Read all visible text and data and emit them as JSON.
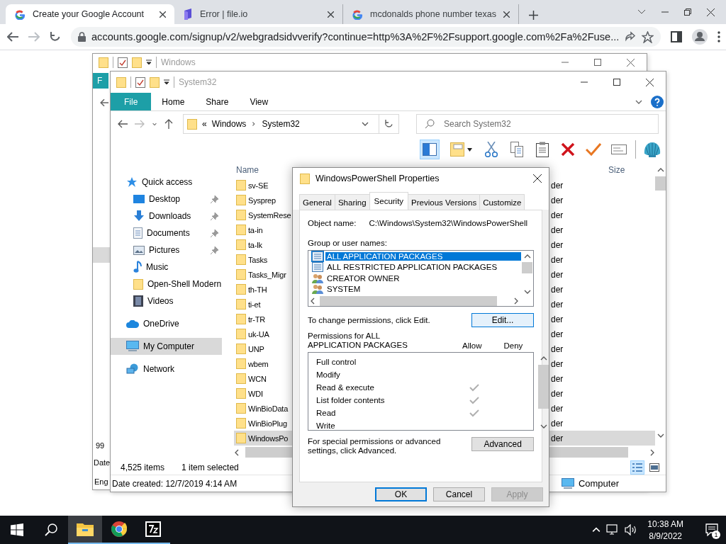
{
  "browser": {
    "tabs": [
      {
        "title": "Create your Google Account",
        "kind": "google",
        "selected": true
      },
      {
        "title": "Error | file.io",
        "kind": "fileio",
        "selected": false
      },
      {
        "title": "mcdonalds phone number texas",
        "kind": "google",
        "selected": false
      }
    ],
    "url": "accounts.google.com/signup/v2/webgradsidvverify?continue=http%3A%2F%2Fsupport.google.com%2Fa%2Fuse..."
  },
  "back_window": {
    "title": "Windows",
    "ribbon_tab": "F",
    "item_count": "99",
    "status_text": "Date",
    "details_text": "Eng"
  },
  "explorer": {
    "title": "System32",
    "ribbon_tabs": [
      {
        "label": "File",
        "selected": true
      },
      {
        "label": "Home",
        "selected": false
      },
      {
        "label": "Share",
        "selected": false
      },
      {
        "label": "View",
        "selected": false
      }
    ],
    "address": {
      "overflow": "«",
      "crumbs": [
        "Windows",
        "System32"
      ]
    },
    "search": {
      "placeholder": "Search System32"
    },
    "nav": [
      {
        "label": "Quick access",
        "kind": "star",
        "selected": false,
        "children": [
          {
            "label": "Desktop",
            "kind": "desktop",
            "pinned": true
          },
          {
            "label": "Downloads",
            "kind": "downloads",
            "pinned": true
          },
          {
            "label": "Documents",
            "kind": "documents",
            "pinned": true
          },
          {
            "label": "Pictures",
            "kind": "pictures",
            "pinned": true
          },
          {
            "label": "Music",
            "kind": "music",
            "pinned": false
          },
          {
            "label": "Open-Shell Modern",
            "kind": "folder",
            "pinned": false
          },
          {
            "label": "Videos",
            "kind": "videos",
            "pinned": false
          }
        ]
      },
      {
        "label": "OneDrive",
        "kind": "cloud",
        "selected": false
      },
      {
        "label": "My Computer",
        "kind": "computer",
        "selected": true
      },
      {
        "label": "Network",
        "kind": "network",
        "selected": false
      }
    ],
    "columns": [
      "Name",
      "Size"
    ],
    "rows": [
      {
        "name": "sv-SE",
        "type": "der",
        "selected": false
      },
      {
        "name": "Sysprep",
        "type": "der",
        "selected": false
      },
      {
        "name": "SystemRese",
        "type": "der",
        "selected": false
      },
      {
        "name": "ta-in",
        "type": "der",
        "selected": false
      },
      {
        "name": "ta-lk",
        "type": "der",
        "selected": false
      },
      {
        "name": "Tasks",
        "type": "der",
        "selected": false
      },
      {
        "name": "Tasks_Migr",
        "type": "der",
        "selected": false
      },
      {
        "name": "th-TH",
        "type": "der",
        "selected": false
      },
      {
        "name": "ti-et",
        "type": "der",
        "selected": false
      },
      {
        "name": "tr-TR",
        "type": "der",
        "selected": false
      },
      {
        "name": "uk-UA",
        "type": "der",
        "selected": false
      },
      {
        "name": "UNP",
        "type": "der",
        "selected": false
      },
      {
        "name": "wbem",
        "type": "der",
        "selected": false
      },
      {
        "name": "WCN",
        "type": "der",
        "selected": false
      },
      {
        "name": "WDI",
        "type": "der",
        "selected": false
      },
      {
        "name": "WinBioData",
        "type": "der",
        "selected": false
      },
      {
        "name": "WinBioPlug",
        "type": "der",
        "selected": false
      },
      {
        "name": "WindowsPo",
        "type": "der",
        "selected": true
      }
    ],
    "status": {
      "items": "4,525 items",
      "selection": "1 item selected"
    },
    "details": {
      "date": "Date created: 12/7/2019 4:14 AM",
      "location": "Computer"
    }
  },
  "dialog": {
    "title": "WindowsPowerShell Properties",
    "tabs": [
      {
        "label": "General",
        "selected": false
      },
      {
        "label": "Sharing",
        "selected": false
      },
      {
        "label": "Security",
        "selected": true
      },
      {
        "label": "Previous Versions",
        "selected": false
      },
      {
        "label": "Customize",
        "selected": false
      }
    ],
    "object_label": "Object name:",
    "object_value": "C:\\Windows\\System32\\WindowsPowerShell",
    "groups_label": "Group or user names:",
    "groups": [
      {
        "name": "ALL APPLICATION PACKAGES",
        "kind": "package",
        "selected": true
      },
      {
        "name": "ALL RESTRICTED APPLICATION PACKAGES",
        "kind": "package",
        "selected": false
      },
      {
        "name": "CREATOR OWNER",
        "kind": "users",
        "selected": false
      },
      {
        "name": "SYSTEM",
        "kind": "users",
        "selected": false
      }
    ],
    "change_hint": "To change permissions, click Edit.",
    "edit_button": "Edit...",
    "permissions_label": "Permissions for ALL APPLICATION PACKAGES",
    "allow_label": "Allow",
    "deny_label": "Deny",
    "permissions": [
      {
        "name": "Full control",
        "allow": false,
        "deny": false
      },
      {
        "name": "Modify",
        "allow": false,
        "deny": false
      },
      {
        "name": "Read & execute",
        "allow": true,
        "deny": false
      },
      {
        "name": "List folder contents",
        "allow": true,
        "deny": false
      },
      {
        "name": "Read",
        "allow": true,
        "deny": false
      },
      {
        "name": "Write",
        "allow": false,
        "deny": false
      }
    ],
    "advanced_hint": "For special permissions or advanced settings, click Advanced.",
    "advanced_button": "Advanced",
    "buttons": [
      {
        "label": "OK",
        "default": true,
        "disabled": false
      },
      {
        "label": "Cancel",
        "default": false,
        "disabled": false
      },
      {
        "label": "Apply",
        "default": false,
        "disabled": true
      }
    ]
  },
  "taskbar": {
    "apps": [
      {
        "kind": "explorer",
        "active": true
      },
      {
        "kind": "chrome",
        "active": false
      },
      {
        "kind": "sevenzip",
        "active": false
      }
    ],
    "time": "10:38 AM",
    "date": "8/9/2022",
    "notifications": "1"
  }
}
